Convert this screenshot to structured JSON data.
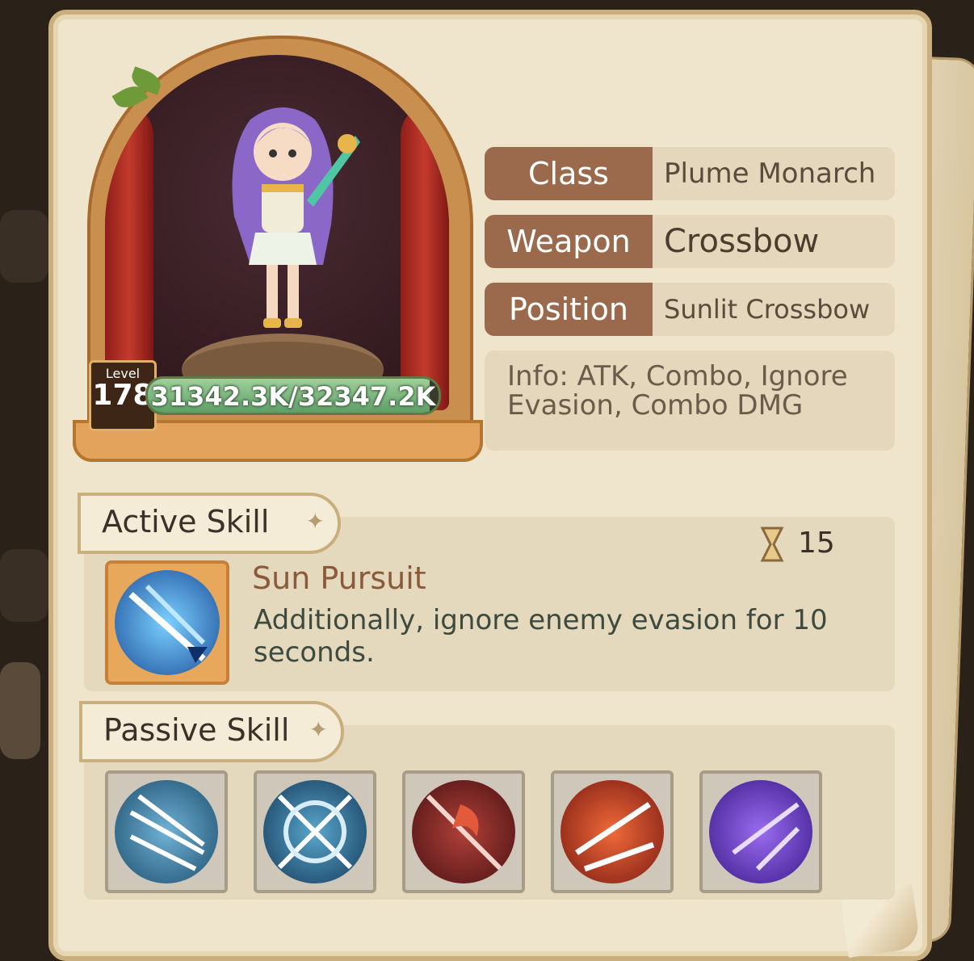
{
  "hero": {
    "level_label": "Level",
    "level": "178",
    "exp_text": "31342.3K/32347.2K",
    "exp_fraction": 0.969
  },
  "info": {
    "rows": [
      {
        "key": "Class",
        "value": "Plume Monarch"
      },
      {
        "key": "Weapon",
        "value": "Crossbow"
      },
      {
        "key": "Position",
        "value": "Sunlit Crossbow"
      }
    ],
    "description": "Info: ATK, Combo, Ignore Evasion, Combo DMG"
  },
  "active_skill": {
    "tab_label": "Active Skill",
    "name": "Sun Pursuit",
    "cooldown": "15",
    "description": "Additionally, ignore enemy evasion for 10 seconds.",
    "icon": "crossbow-bolt-icon"
  },
  "passive_skill": {
    "tab_label": "Passive Skill",
    "icons": [
      "triple-arrow-icon",
      "crossed-bow-icon",
      "flame-arrow-icon",
      "fire-arrows-icon",
      "purple-arrow-icon"
    ]
  },
  "colors": {
    "panel": "#efe5cd",
    "key_bg": "#9b6a4c",
    "exp_fill": "#5f9e68"
  }
}
